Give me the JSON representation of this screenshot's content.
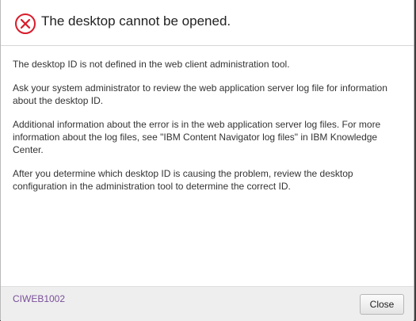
{
  "dialog": {
    "title": "The desktop cannot be opened.",
    "icon": "error-circle-x-icon",
    "icon_color": "#d91b2a",
    "paragraphs": [
      "The desktop ID is not defined in the web client administration tool.",
      "Ask your system administrator to review the web application server log file for information about the desktop ID.",
      "Additional information about the error is in the web application server log files. For more information about the log files, see \"IBM Content Navigator log files\" in IBM Knowledge Center.",
      "After you determine which desktop ID is causing the problem, review the desktop configuration in the administration tool to determine the correct ID."
    ],
    "message_id": "CIWEB1002",
    "close_label": "Close"
  }
}
